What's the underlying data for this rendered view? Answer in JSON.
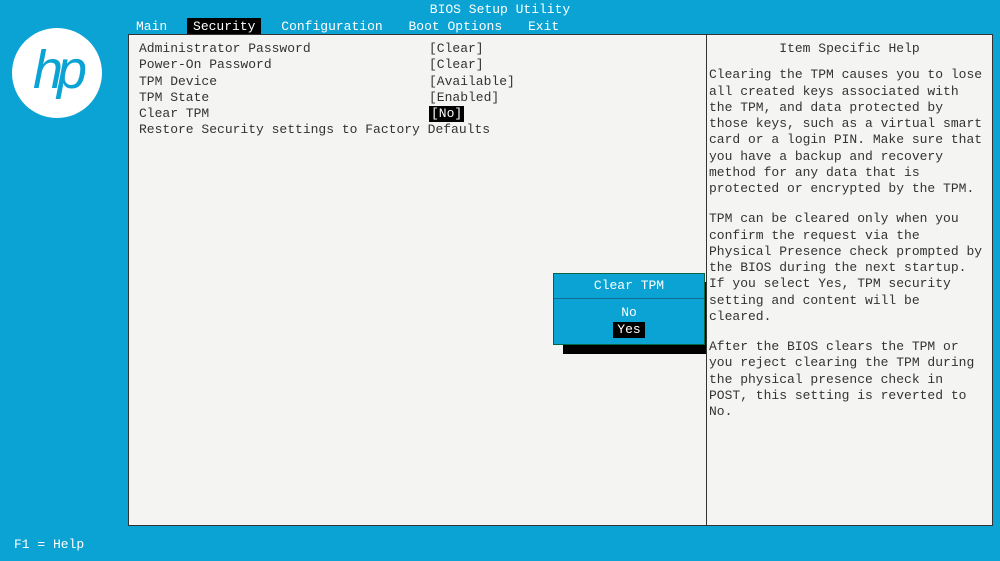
{
  "title": "BIOS Setup Utility",
  "menu": {
    "items": [
      "Main",
      "Security",
      "Configuration",
      "Boot Options",
      "Exit"
    ],
    "active_index": 1
  },
  "logo_text": "hp",
  "settings": [
    {
      "label": "Administrator Password",
      "value": "[Clear]",
      "selected": false
    },
    {
      "label": "Power-On Password",
      "value": "[Clear]",
      "selected": false
    },
    {
      "label": "TPM Device",
      "value": "[Available]",
      "selected": false
    },
    {
      "label": "TPM State",
      "value": "[Enabled]",
      "selected": false
    },
    {
      "label": "Clear TPM",
      "value": "[No]",
      "selected": true
    }
  ],
  "action_row": "Restore Security settings to Factory Defaults",
  "help": {
    "title": "Item Specific Help",
    "p1": "Clearing the TPM causes you to lose all created keys associated with the TPM, and data protected by those keys, such as a virtual smart card or a login PIN. Make sure that you have a backup and recovery method for any data that is protected or encrypted by the TPM.",
    "p2": "TPM can be cleared only when you confirm the request via the Physical Presence check prompted by the BIOS during the next startup. If you select Yes, TPM security setting and content will be cleared.",
    "p3": "After the BIOS clears the TPM or you reject clearing the TPM during the physical presence check in POST, this setting is reverted to No."
  },
  "popup": {
    "title": "Clear TPM",
    "options": [
      "No",
      "Yes"
    ],
    "highlight_index": 1
  },
  "footer": "F1 = Help"
}
